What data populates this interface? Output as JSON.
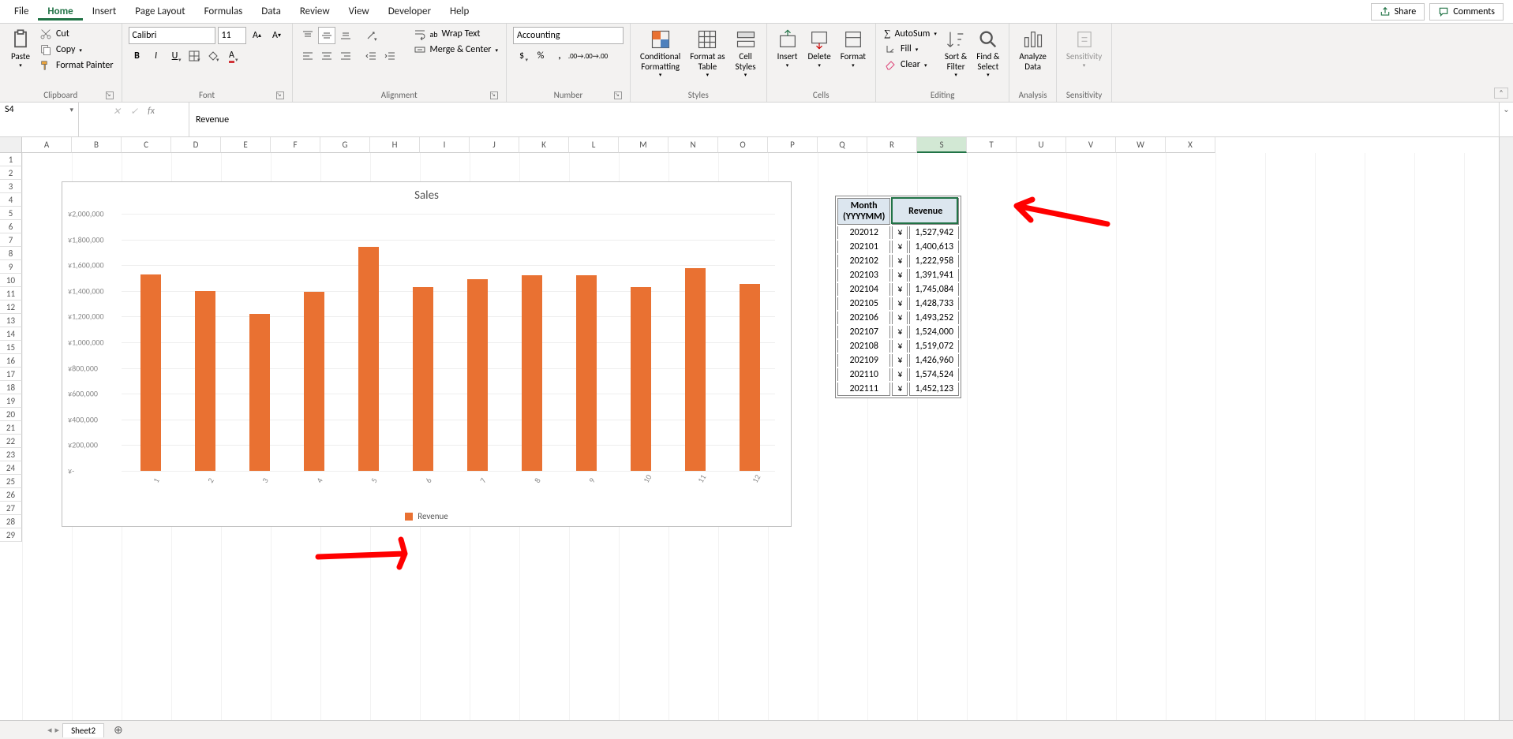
{
  "tabs": [
    "File",
    "Home",
    "Insert",
    "Page Layout",
    "Formulas",
    "Data",
    "Review",
    "View",
    "Developer",
    "Help"
  ],
  "active_tab": "Home",
  "share": "Share",
  "comments": "Comments",
  "clipboard": {
    "paste": "Paste",
    "cut": "Cut",
    "copy": "Copy",
    "fp": "Format Painter",
    "label": "Clipboard"
  },
  "font": {
    "name": "Calibri",
    "size": "11",
    "label": "Font"
  },
  "alignment": {
    "wrap": "Wrap Text",
    "merge": "Merge & Center",
    "label": "Alignment"
  },
  "number": {
    "format": "Accounting",
    "label": "Number"
  },
  "styles": {
    "cf": "Conditional\nFormatting",
    "fat": "Format as\nTable",
    "cs": "Cell\nStyles",
    "label": "Styles"
  },
  "cells": {
    "ins": "Insert",
    "del": "Delete",
    "fmt": "Format",
    "label": "Cells"
  },
  "editing": {
    "as": "AutoSum",
    "fill": "Fill",
    "clear": "Clear",
    "sort": "Sort &\nFilter",
    "find": "Find &\nSelect",
    "label": "Editing"
  },
  "analysis": {
    "an": "Analyze\nData",
    "label": "Analysis"
  },
  "sensitivity": {
    "s": "Sensitivity",
    "label": "Sensitivity"
  },
  "namebox": "S4",
  "formula": "Revenue",
  "columns": [
    "A",
    "B",
    "C",
    "D",
    "E",
    "F",
    "G",
    "H",
    "I",
    "J",
    "K",
    "L",
    "M",
    "N",
    "O",
    "P",
    "Q",
    "R",
    "S",
    "T",
    "U",
    "V",
    "W",
    "X"
  ],
  "selected_col": "S",
  "row_count": 29,
  "chart_data": {
    "type": "bar",
    "title": "Sales",
    "categories": [
      "1",
      "2",
      "3",
      "4",
      "5",
      "6",
      "7",
      "8",
      "9",
      "10",
      "11",
      "12"
    ],
    "series": [
      {
        "name": "Revenue",
        "values": [
          1527942,
          1400613,
          1222958,
          1391941,
          1745084,
          1428733,
          1493252,
          1524000,
          1519072,
          1426960,
          1574524,
          1452123
        ]
      }
    ],
    "ylim": [
      0,
      2000000
    ],
    "ytick": 200000,
    "y_prefix": "¥",
    "legend": "Revenue"
  },
  "table": {
    "headers": [
      "Month\n(YYYYMM)",
      "Revenue"
    ],
    "currency": "¥",
    "rows": [
      [
        "202012",
        "1,527,942"
      ],
      [
        "202101",
        "1,400,613"
      ],
      [
        "202102",
        "1,222,958"
      ],
      [
        "202103",
        "1,391,941"
      ],
      [
        "202104",
        "1,745,084"
      ],
      [
        "202105",
        "1,428,733"
      ],
      [
        "202106",
        "1,493,252"
      ],
      [
        "202107",
        "1,524,000"
      ],
      [
        "202108",
        "1,519,072"
      ],
      [
        "202109",
        "1,426,960"
      ],
      [
        "202110",
        "1,574,524"
      ],
      [
        "202111",
        "1,452,123"
      ]
    ]
  },
  "sheet_tabs": [
    "Sheet2"
  ]
}
